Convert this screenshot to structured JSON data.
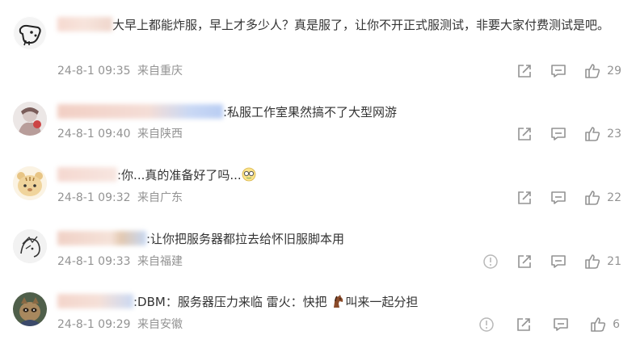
{
  "comments": [
    {
      "content": "大早上都能炸服，早上才多少人？真是服了，让你不开正式服测试，非要大家付费测试是吧。",
      "time": "24-8-1 09:35",
      "location": "来自重庆",
      "likes": "29",
      "has_report": false
    },
    {
      "content": ":私服工作室果然搞不了大型网游",
      "time": "24-8-1 09:40",
      "location": "来自陕西",
      "likes": "23",
      "has_report": false
    },
    {
      "content_before": ":你...真的准备好了吗...",
      "emoji": "glasses-face-emoji",
      "time": "24-8-1 09:32",
      "location": "来自广东",
      "likes": "22",
      "has_report": false
    },
    {
      "content": ":让你把服务器都拉去给怀旧服脚本用",
      "time": "24-8-1 09:33",
      "location": "来自福建",
      "likes": "21",
      "has_report": true
    },
    {
      "content_before": ":DBM：服务器压力来临 雷火：快把",
      "emoji": "horse-emoji",
      "content_after": "叫来一起分担",
      "time": "24-8-1 09:29",
      "location": "来自安徽",
      "likes": "6",
      "has_report": true
    }
  ],
  "icons": {
    "share": "share-icon",
    "comment": "comment-icon",
    "like": "thumbs-up-icon",
    "report": "report-icon"
  }
}
